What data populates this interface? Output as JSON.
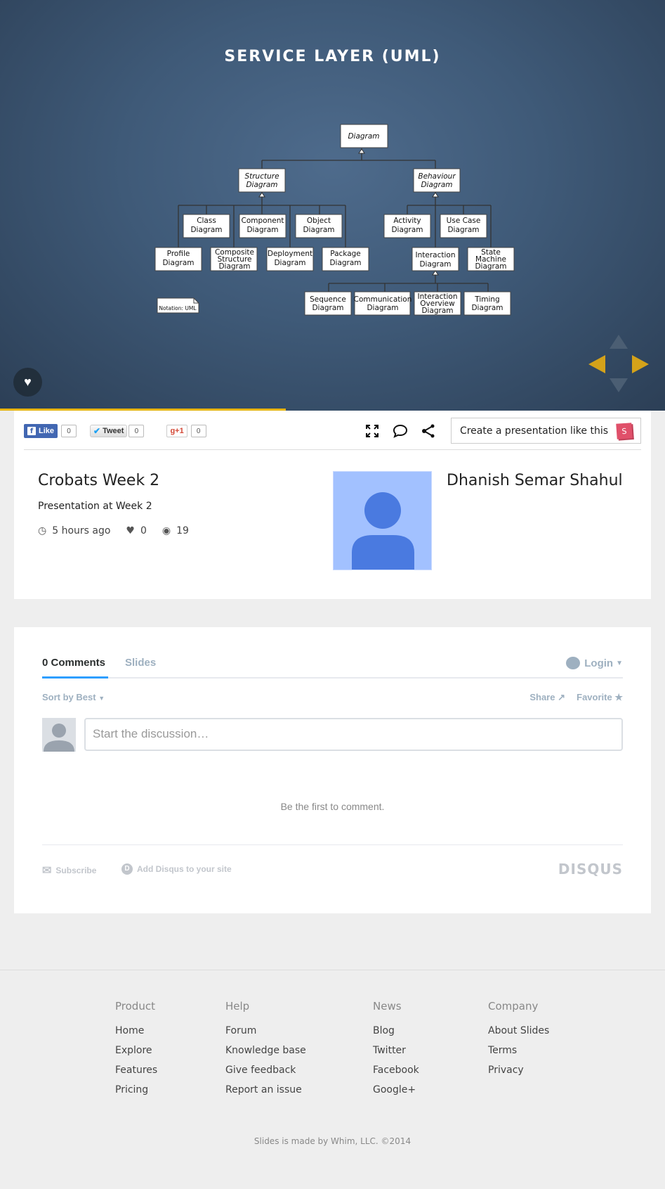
{
  "slide": {
    "title": "SERVICE LAYER (UML)",
    "diagram": {
      "root": "Diagram",
      "structure": [
        "Structure",
        "Diagram"
      ],
      "behaviour": [
        "Behaviour",
        "Diagram"
      ],
      "class": [
        "Class",
        "Diagram"
      ],
      "component": [
        "Component",
        "Diagram"
      ],
      "object": [
        "Object",
        "Diagram"
      ],
      "profile": [
        "Profile",
        "Diagram"
      ],
      "composite": [
        "Composite",
        "Structure",
        "Diagram"
      ],
      "deployment": [
        "Deployment",
        "Diagram"
      ],
      "package": [
        "Package",
        "Diagram"
      ],
      "activity": [
        "Activity",
        "Diagram"
      ],
      "usecase": [
        "Use Case",
        "Diagram"
      ],
      "interaction": [
        "Interaction",
        "Diagram"
      ],
      "statemachine": [
        "State",
        "Machine",
        "Diagram"
      ],
      "sequence": [
        "Sequence",
        "Diagram"
      ],
      "communication": [
        "Communication",
        "Diagram"
      ],
      "overview": [
        "Interaction",
        "Overview",
        "Diagram"
      ],
      "timing": [
        "Timing",
        "Diagram"
      ],
      "notation": "Notation: UML"
    },
    "progress": 0.43
  },
  "social": {
    "fb_label": "Like",
    "fb_count": "0",
    "tw_label": "Tweet",
    "tw_count": "0",
    "gp_label": "g+1",
    "gp_count": "0"
  },
  "toolbar": {
    "create_label": "Create a presentation like this",
    "create_badge": "S"
  },
  "deck": {
    "title": "Crobats Week 2",
    "description": "Presentation at Week 2",
    "time": "5 hours ago",
    "likes": "0",
    "views": "19",
    "author": "Dhanish Semar Shahul"
  },
  "comments": {
    "tab_comments": "0 Comments",
    "tab_slides": "Slides",
    "login": "Login",
    "sort": "Sort by Best",
    "share": "Share",
    "favorite": "Favorite",
    "placeholder": "Start the discussion…",
    "empty": "Be the first to comment.",
    "subscribe": "Subscribe",
    "add_disqus": "Add Disqus to your site",
    "brand": "DISQUS"
  },
  "footer": {
    "columns": [
      {
        "heading": "Product",
        "links": [
          "Home",
          "Explore",
          "Features",
          "Pricing"
        ]
      },
      {
        "heading": "Help",
        "links": [
          "Forum",
          "Knowledge base",
          "Give feedback",
          "Report an issue"
        ]
      },
      {
        "heading": "News",
        "links": [
          "Blog",
          "Twitter",
          "Facebook",
          "Google+"
        ]
      },
      {
        "heading": "Company",
        "links": [
          "About Slides",
          "Terms",
          "Privacy"
        ]
      }
    ],
    "copyright": "Slides is made by Whim, LLC. ©2014"
  },
  "colors": {
    "accent": "#e8b400",
    "fb": "#4267b2",
    "disqus_tab": "#2e9fff",
    "avatar_bg": "#a2c1ff",
    "avatar_fg": "#4a7ae0"
  }
}
